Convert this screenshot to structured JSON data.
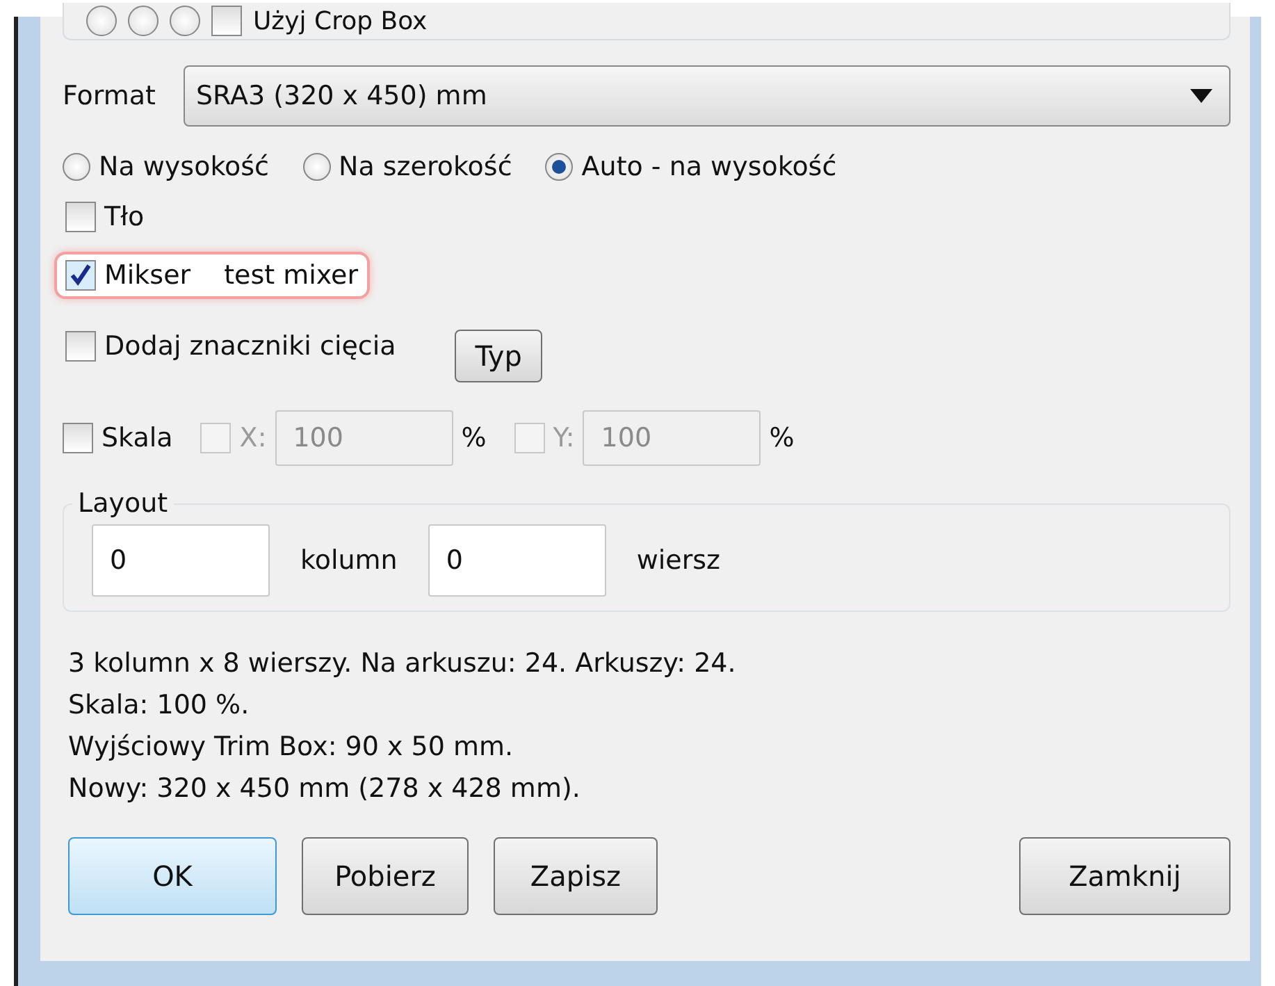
{
  "top_group": {
    "radios": [
      {
        "selected": false
      },
      {
        "selected": false
      },
      {
        "selected": false
      }
    ],
    "crop_box": {
      "label": "Użyj Crop Box",
      "checked": false
    }
  },
  "format": {
    "label": "Format",
    "value": "SRA3 (320 x 450) mm"
  },
  "orientation": [
    {
      "label": "Na wysokość",
      "selected": false
    },
    {
      "label": "Na szerokość",
      "selected": false
    },
    {
      "label": "Auto - na wysokość",
      "selected": true
    }
  ],
  "options": [
    {
      "label": "Tło",
      "checked": false,
      "highlighted": false
    },
    {
      "label": "Mikser",
      "note": "test mixer",
      "checked": true,
      "highlighted": true
    },
    {
      "label": "Dodaj znaczniki cięcia",
      "checked": false,
      "highlighted": false,
      "button": "Typ"
    }
  ],
  "scale": {
    "label": "Skala",
    "checked": false,
    "axes": [
      {
        "label": "X:",
        "checked": false,
        "value": "100",
        "unit": "%",
        "disabled": true
      },
      {
        "label": "Y:",
        "checked": false,
        "value": "100",
        "unit": "%",
        "disabled": true
      }
    ]
  },
  "layout": {
    "title": "Layout",
    "fields": [
      {
        "value": "0",
        "unit": "kolumn"
      },
      {
        "value": "0",
        "unit": "wiersz"
      }
    ]
  },
  "info": [
    "3 kolumn x 8 wierszy. Na arkuszu: 24. Arkuszy: 24.",
    "Skala: 100 %.",
    "Wyjściowy Trim Box: 90 x 50 mm.",
    "Nowy: 320 x 450 mm (278 x 428 mm)."
  ],
  "buttons": [
    {
      "label": "OK",
      "default": true
    },
    {
      "label": "Pobierz",
      "default": false
    },
    {
      "label": "Zapisz",
      "default": false
    },
    {
      "label": "Zamknij",
      "default": false
    }
  ]
}
